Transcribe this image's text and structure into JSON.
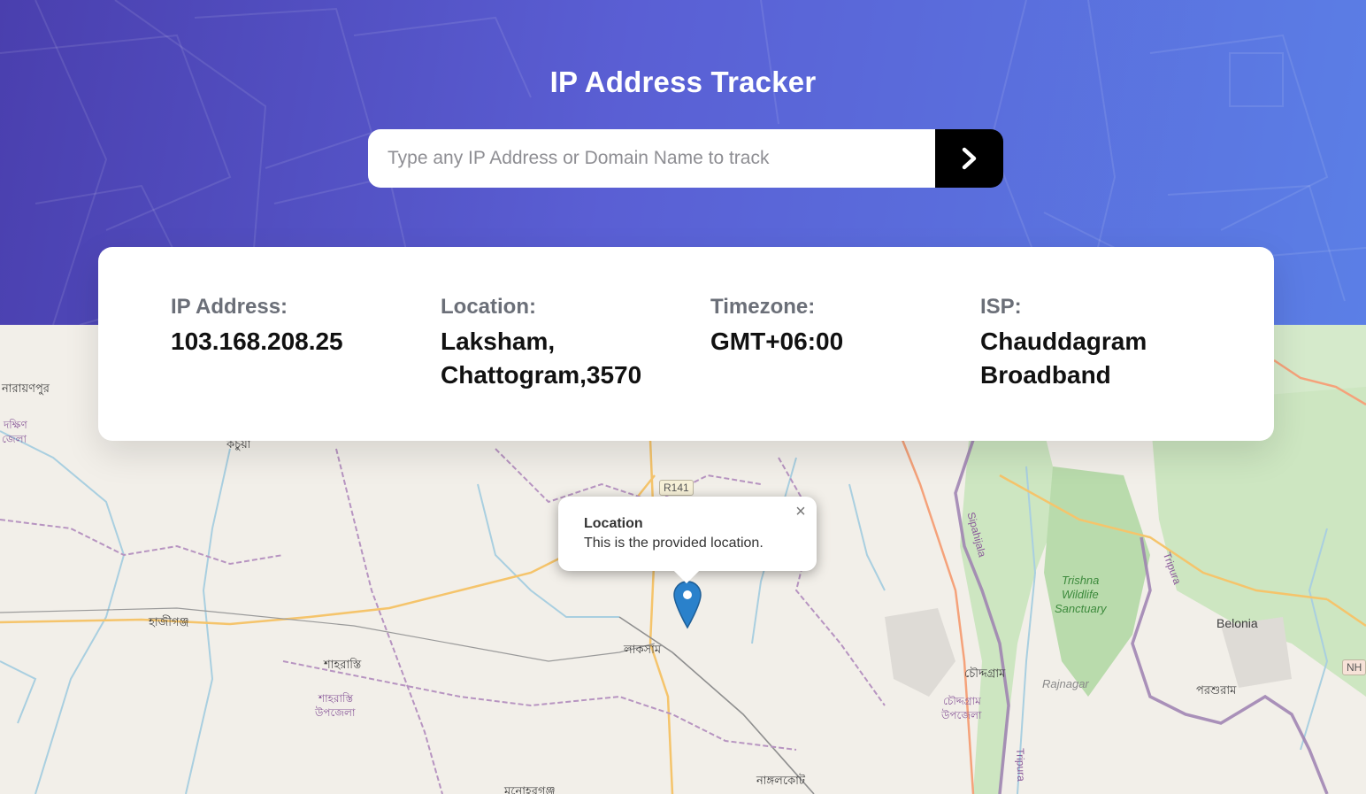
{
  "header": {
    "title": "IP Address Tracker"
  },
  "search": {
    "placeholder": "Type any IP Address or Domain Name to track",
    "value": "",
    "submit_icon": "chevron-right-icon"
  },
  "info": {
    "ip_label": "IP Address:",
    "ip_value": "103.168.208.25",
    "location_label": "Location:",
    "location_line1": "Laksham,",
    "location_line2": "Chattogram,3570",
    "timezone_label": "Timezone:",
    "timezone_value": "GMT+06:00",
    "isp_label": "ISP:",
    "isp_line1": "Chauddagram",
    "isp_line2": "Broadband"
  },
  "map": {
    "popup_title": "Location",
    "popup_text": "This is the provided location.",
    "popup_close": "×",
    "labels": {
      "narayanpur": "নারায়ণপুর",
      "dakshin": "দক্ষিণ",
      "upazila1": "জেলা",
      "kachua": "কচুয়া",
      "hajiganj": "হাজীগঞ্জ",
      "shahrasti": "শাহরাস্তি",
      "shahrasti_up1": "শাহরাস্তি",
      "shahrasti_up2": "উপজেলা",
      "laksham": "লাকসাম",
      "chauddagram": "চৌদ্দগ্রাম",
      "chauddagram_up1": "চৌদ্দগ্রাম",
      "chauddagram_up2": "উপজেলা",
      "nangalkot": "নাঙ্গলকোট",
      "manoharganj": "মনোহরগঞ্জ",
      "porshuram": "পরশুরাম",
      "belonia": "Belonia",
      "spahijala": "Sipahijala",
      "tripura1": "Tripura",
      "tripura2": "Tripura",
      "trishna1": "Trishna",
      "trishna2": "Wildlife",
      "trishna3": "Sanctuary",
      "rajnagar": "Rajnagar",
      "r141": "R141",
      "nh": "NH"
    }
  },
  "colors": {
    "hero_start": "#4a3fae",
    "hero_end": "#5b7fe6",
    "button": "#000000",
    "marker": "#2a81cb"
  }
}
